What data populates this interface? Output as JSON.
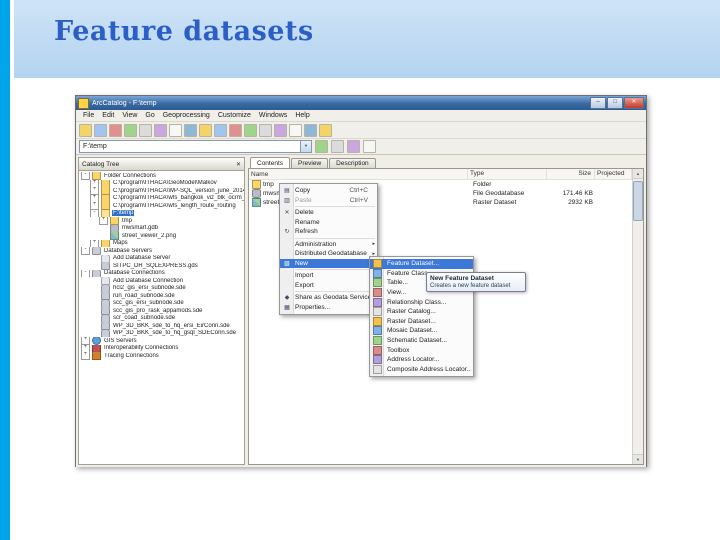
{
  "slide": {
    "title": "Feature datasets"
  },
  "colors": {
    "accent_stripe": "#00a4ea",
    "header_band": "#b2d4f0",
    "title_text": "#2b5fc7",
    "selection": "#3c78d8"
  },
  "window": {
    "title": "ArcCatalog - F:\\temp",
    "menu_items": [
      "File",
      "Edit",
      "View",
      "Go",
      "Geoprocessing",
      "Customize",
      "Windows",
      "Help"
    ],
    "toolbar_icons": [
      "up-one-level",
      "connect-folder",
      "disconnect-folder",
      "copy",
      "paste",
      "delete",
      "large-icons-view",
      "list-view",
      "details-view",
      "thumbnails-view",
      "launch-arcmap",
      "modelbuilder",
      "python-window",
      "search-window",
      "arctoolbox",
      "arcglobe",
      "help"
    ],
    "address": {
      "value": "F:\\temp",
      "icons": [
        "go-to-location",
        "up-arrow",
        "refresh-view",
        "options"
      ]
    },
    "catalog_tree": {
      "header": "Catalog Tree",
      "items": [
        {
          "label": "Folder Connections",
          "level": 0,
          "icon": "folder-connections",
          "expander": "-"
        },
        {
          "label": "C:\\program\\ITHACA\\GeoModel\\Malkov",
          "level": 1,
          "icon": "folder",
          "expander": "+"
        },
        {
          "label": "C:\\program\\ITHACA\\WP-SQL_version_june_2014",
          "level": 1,
          "icon": "folder",
          "expander": "+"
        },
        {
          "label": "C:\\program\\ITHACA\\wfs_bangkok_viz_blk_ocrm_files",
          "level": 1,
          "icon": "folder",
          "expander": "+"
        },
        {
          "label": "C:\\program\\ITHACA\\wfs_length_route_routing",
          "level": 1,
          "icon": "folder",
          "expander": "+"
        },
        {
          "label": "F:\\temp",
          "level": 1,
          "icon": "folder-open",
          "expander": "-",
          "selected": true
        },
        {
          "label": "tmp",
          "level": 2,
          "icon": "folder",
          "expander": "+"
        },
        {
          "label": "mwsmart.gdb",
          "level": 2,
          "icon": "geodatabase"
        },
        {
          "label": "street_viewer_2.png",
          "level": 2,
          "icon": "raster"
        },
        {
          "label": "Maps",
          "level": 1,
          "icon": "folder",
          "expander": "+"
        },
        {
          "label": "Database Servers",
          "level": 0,
          "icon": "db-servers",
          "expander": "-"
        },
        {
          "label": "Add Database Server",
          "level": 1,
          "icon": "db-add"
        },
        {
          "label": "SITPC_DR_SQLEXPRESS.gds",
          "level": 1,
          "icon": "db-server"
        },
        {
          "label": "Database Connections",
          "level": 0,
          "icon": "db-connections",
          "expander": "-"
        },
        {
          "label": "Add Database Connection",
          "level": 1,
          "icon": "db-add"
        },
        {
          "label": "hcl2_gis_ersi_subnode.sde",
          "level": 1,
          "icon": "db-conn"
        },
        {
          "label": "run_road_subnode.sde",
          "level": 1,
          "icon": "db-conn"
        },
        {
          "label": "scc_gis_ersi_subnode.sde",
          "level": 1,
          "icon": "db-conn"
        },
        {
          "label": "scc_gis_pro_rask_appamods.sde",
          "level": 1,
          "icon": "db-conn"
        },
        {
          "label": "scr_coad_subnode.sde",
          "level": 1,
          "icon": "db-conn"
        },
        {
          "label": "WP_3D_BKK_sde_to_hq_ersi_EirConn.sde",
          "level": 1,
          "icon": "db-conn"
        },
        {
          "label": "WP_3D_BKK_sde_to_hq_gsql_SDEConn.sde",
          "level": 1,
          "icon": "db-conn"
        },
        {
          "label": "GIS Servers",
          "level": 0,
          "icon": "globe",
          "expander": "+"
        },
        {
          "label": "Interoperability Connections",
          "level": 0,
          "icon": "interop",
          "expander": "+"
        },
        {
          "label": "Tracing Connections",
          "level": 0,
          "icon": "tracing",
          "expander": "+"
        }
      ]
    },
    "contents_panel": {
      "tabs": [
        {
          "label": "Contents",
          "active": true
        },
        {
          "label": "Preview",
          "active": false
        },
        {
          "label": "Description",
          "active": false
        }
      ],
      "columns": [
        "Name",
        "Type",
        "Size",
        "Projected"
      ],
      "rows": [
        {
          "name": "tmp",
          "type": "Folder",
          "size": "",
          "icon": "folder"
        },
        {
          "name": "mwsmart.gdb",
          "type": "File Geodatabase",
          "size": "171.46 KB",
          "icon": "geodatabase"
        },
        {
          "name": "street_viewer_2.png",
          "type": "Raster Dataset",
          "size": "2932 KB",
          "icon": "raster"
        }
      ]
    },
    "context_menu": {
      "items": [
        {
          "label": "Copy",
          "shortcut": "Ctrl+C",
          "icon": "copy"
        },
        {
          "label": "Paste",
          "shortcut": "Ctrl+V",
          "icon": "paste",
          "disabled": true
        },
        {
          "type": "separator"
        },
        {
          "label": "Delete",
          "icon": "delete"
        },
        {
          "label": "Rename"
        },
        {
          "label": "Refresh",
          "icon": "refresh"
        },
        {
          "type": "separator"
        },
        {
          "label": "Administration",
          "submenu": true
        },
        {
          "label": "Distributed Geodatabase",
          "submenu": true
        },
        {
          "label": "New",
          "submenu": true,
          "highlighted": true,
          "icon": "new"
        },
        {
          "type": "separator"
        },
        {
          "label": "Import",
          "submenu": true
        },
        {
          "label": "Export",
          "submenu": true
        },
        {
          "type": "separator"
        },
        {
          "label": "Share as Geodata Service...",
          "icon": "share"
        },
        {
          "label": "Properties...",
          "icon": "properties"
        }
      ]
    },
    "new_submenu": {
      "items": [
        {
          "label": "Feature Dataset...",
          "highlighted": true,
          "icon": "feature-dataset"
        },
        {
          "label": "Feature Class...",
          "icon": "feature-class"
        },
        {
          "label": "Table...",
          "icon": "table"
        },
        {
          "label": "View...",
          "icon": "view"
        },
        {
          "label": "Relationship Class...",
          "icon": "relationship-class"
        },
        {
          "label": "Raster Catalog...",
          "icon": "raster-catalog"
        },
        {
          "label": "Raster Dataset...",
          "icon": "raster-dataset"
        },
        {
          "label": "Mosaic Dataset...",
          "icon": "mosaic-dataset"
        },
        {
          "label": "Schematic Dataset...",
          "icon": "schematic-dataset"
        },
        {
          "label": "Toolbox",
          "icon": "toolbox"
        },
        {
          "label": "Address Locator...",
          "icon": "address-locator"
        },
        {
          "label": "Composite Address Locator...",
          "icon": "composite-address-locator"
        }
      ]
    },
    "tooltip": {
      "title": "New Feature Dataset",
      "body": "Creates a new feature dataset"
    }
  }
}
